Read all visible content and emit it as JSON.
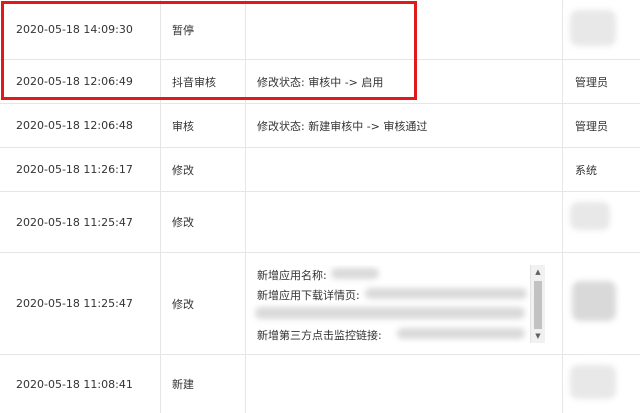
{
  "rows": [
    {
      "time": "2020-05-18 14:09:30",
      "action": "暂停",
      "detail": "",
      "operator": ""
    },
    {
      "time": "2020-05-18 12:06:49",
      "action": "抖音审核",
      "detail": "修改状态: 审核中 -> 启用",
      "operator": "管理员"
    },
    {
      "time": "2020-05-18 12:06:48",
      "action": "审核",
      "detail": "修改状态: 新建审核中 -> 审核通过",
      "operator": "管理员"
    },
    {
      "time": "2020-05-18 11:26:17",
      "action": "修改",
      "detail": "",
      "operator": "系统"
    },
    {
      "time": "2020-05-18 11:25:47",
      "action": "修改",
      "detail": "",
      "operator": ""
    },
    {
      "time": "2020-05-18 11:25:47",
      "action": "修改",
      "detail": "",
      "operator": "",
      "detail_lines": [
        "新增应用名称:",
        "新增应用下载详情页:",
        "新增第三方点击监控链接:"
      ]
    },
    {
      "time": "2020-05-18 11:08:41",
      "action": "新建",
      "detail": "",
      "operator": ""
    }
  ],
  "highlight_color": "#e0191b"
}
